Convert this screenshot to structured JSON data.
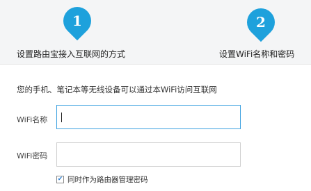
{
  "steps": [
    {
      "number": "1",
      "label": "设置路由宝接入互联网的方式"
    },
    {
      "number": "2",
      "label": "设置WiFi名称和密码"
    }
  ],
  "intro_text": "您的手机、笔记本等无线设备可以通过本WiFi访问互联网",
  "form": {
    "wifi_name_label": "WiFi名称",
    "wifi_name_value": "",
    "wifi_password_label": "WiFi密码",
    "wifi_password_value": "",
    "admin_checkbox_label": "同时作为路由器管理密码",
    "admin_checkbox_checked": true
  },
  "colors": {
    "accent": "#1ea1dc",
    "focus_border": "#3aa0e0",
    "step_background": "#f4f5f6"
  },
  "icons": {
    "step_marker": "map-pin-icon",
    "checkbox_mark": "checkmark-icon"
  }
}
